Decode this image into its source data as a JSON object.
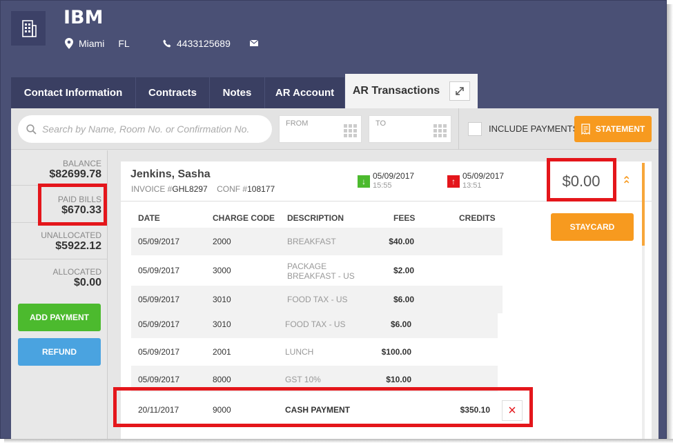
{
  "header": {
    "company": "IBM",
    "city": "Miami",
    "state": "FL",
    "phone": "4433125689"
  },
  "tabs": [
    {
      "label": "Contact Information",
      "active": false
    },
    {
      "label": "Contracts",
      "active": false
    },
    {
      "label": "Notes",
      "active": false
    },
    {
      "label": "AR Account",
      "active": false
    },
    {
      "label": "AR Transactions",
      "active": true
    }
  ],
  "toolbar": {
    "search_placeholder": "Search by Name, Room No. or Confirmation No.",
    "from_label": "FROM",
    "to_label": "TO",
    "include_payments_label": "INCLUDE PAYMENTS",
    "statement_label": "STATEMENT"
  },
  "sidebar": {
    "balance_label": "BALANCE",
    "balance_value": "$82699.78",
    "paid_label": "PAID BILLS",
    "paid_value": "$670.33",
    "unallocated_label": "UNALLOCATED",
    "unallocated_value": "$5922.12",
    "allocated_label": "ALLOCATED",
    "allocated_value": "$0.00",
    "add_payment_label": "ADD PAYMENT",
    "refund_label": "REFUND"
  },
  "bill": {
    "guest_name": "Jenkins, Sasha",
    "invoice_label": "INVOICE #",
    "invoice_no": "GHL8297",
    "conf_label": "CONF #",
    "conf_no": "108177",
    "arrival_date": "05/09/2017",
    "arrival_time": "15:55",
    "departure_date": "05/09/2017",
    "departure_time": "13:51",
    "amount": "$0.00",
    "staycard_label": "STAYCARD"
  },
  "table": {
    "headers": {
      "date": "DATE",
      "code": "CHARGE CODE",
      "desc": "DESCRIPTION",
      "fees": "FEES",
      "credits": "CREDITS"
    },
    "rows": [
      {
        "date": "05/09/2017",
        "code": "2000",
        "desc": "BREAKFAST",
        "fee": "$40.00"
      },
      {
        "date": "05/09/2017",
        "code": "3000",
        "desc": "PACKAGE BREAKFAST - US",
        "fee": "$2.00"
      },
      {
        "date": "05/09/2017",
        "code": "3010",
        "desc": "FOOD TAX - US",
        "fee": "$6.00"
      },
      {
        "date": "05/09/2017",
        "code": "3010",
        "desc": "FOOD TAX - US",
        "fee": "$6.00"
      },
      {
        "date": "05/09/2017",
        "code": "2001",
        "desc": "LUNCH",
        "fee": "$100.00"
      },
      {
        "date": "05/09/2017",
        "code": "8000",
        "desc": "GST 10%",
        "fee": "$10.00"
      }
    ],
    "payment": {
      "date": "20/11/2017",
      "code": "9000",
      "desc": "CASH PAYMENT",
      "credit": "$350.10"
    }
  },
  "colors": {
    "header_bg": "#4a5075",
    "accent_orange": "#f79a1f",
    "green": "#4cba2e",
    "blue": "#4aa3e0",
    "highlight_red": "#e4161b"
  }
}
